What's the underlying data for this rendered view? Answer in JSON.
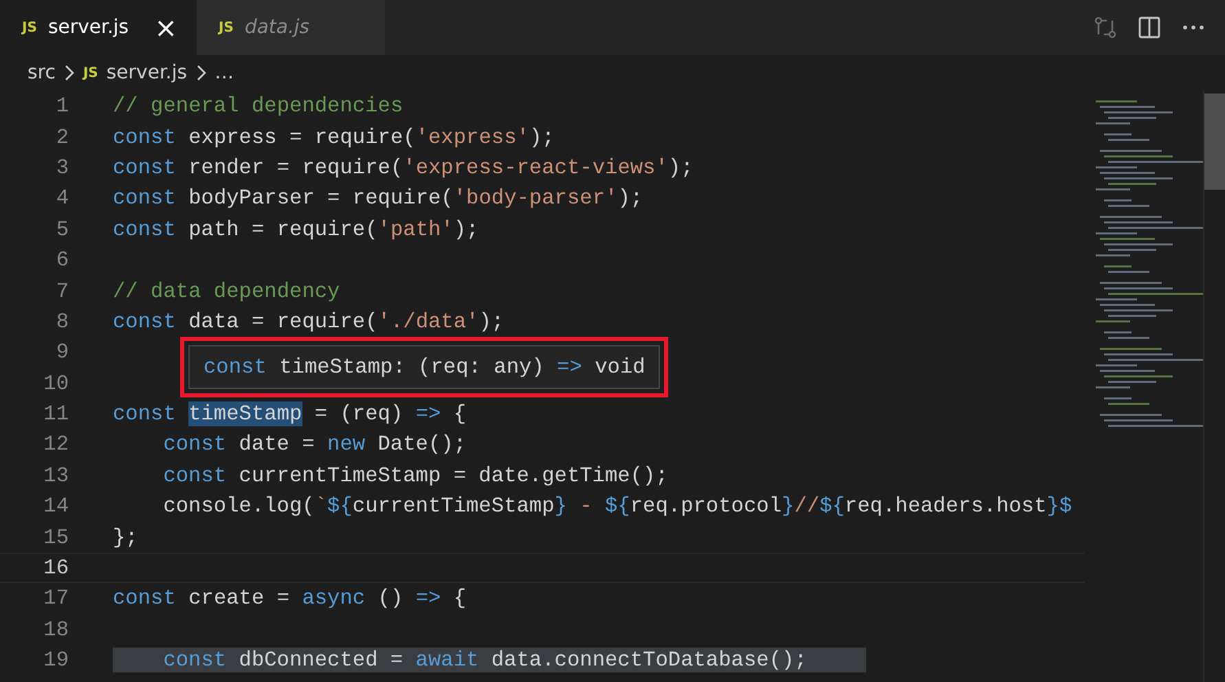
{
  "tabs": [
    {
      "label": "server.js",
      "icon": "JS",
      "selected": true,
      "preview": false,
      "close": "×"
    },
    {
      "label": "data.js",
      "icon": "JS",
      "selected": false,
      "preview": true
    }
  ],
  "breadcrumbs": [
    {
      "label": "src"
    },
    {
      "label": "server.js",
      "icon": "JS"
    },
    {
      "label": "…"
    }
  ],
  "lines": [
    {
      "number": "1",
      "tokens": [
        {
          "kind": "cmt",
          "text": "// general dependencies"
        }
      ]
    },
    {
      "number": "2",
      "tokens": [
        {
          "kind": "kw",
          "text": "const"
        },
        {
          "kind": "id",
          "text": " express = require("
        },
        {
          "kind": "str",
          "text": "'express'"
        },
        {
          "kind": "id",
          "text": ");"
        }
      ]
    },
    {
      "number": "3",
      "tokens": [
        {
          "kind": "kw",
          "text": "const"
        },
        {
          "kind": "id",
          "text": " render = require("
        },
        {
          "kind": "str",
          "text": "'express-react-views'"
        },
        {
          "kind": "id",
          "text": ");"
        }
      ]
    },
    {
      "number": "4",
      "tokens": [
        {
          "kind": "kw",
          "text": "const"
        },
        {
          "kind": "id",
          "text": " bodyParser = require("
        },
        {
          "kind": "str",
          "text": "'body-parser'"
        },
        {
          "kind": "id",
          "text": ");"
        }
      ]
    },
    {
      "number": "5",
      "tokens": [
        {
          "kind": "kw",
          "text": "const"
        },
        {
          "kind": "id",
          "text": " path = require("
        },
        {
          "kind": "str",
          "text": "'path'"
        },
        {
          "kind": "id",
          "text": ");"
        }
      ]
    },
    {
      "number": "6"
    },
    {
      "number": "7",
      "tokens": [
        {
          "kind": "cmt",
          "text": "// data dependency"
        }
      ]
    },
    {
      "number": "8",
      "tokens": [
        {
          "kind": "kw",
          "text": "const"
        },
        {
          "kind": "id",
          "text": " data = require("
        },
        {
          "kind": "str",
          "text": "'./data'"
        },
        {
          "kind": "id",
          "text": ");"
        }
      ]
    },
    {
      "number": "9"
    },
    {
      "number": "10"
    },
    {
      "number": "11",
      "tokens": [
        {
          "kind": "kw",
          "text": "const "
        },
        {
          "kind": "id",
          "text": "timeStamp",
          "highlighted": true
        },
        {
          "kind": "id",
          "text": " = (req) "
        },
        {
          "kind": "kw",
          "text": "=>"
        },
        {
          "kind": "id",
          "text": " {"
        }
      ]
    },
    {
      "number": "12",
      "indent": true,
      "tokens": [
        {
          "kind": "kw",
          "text": "const"
        },
        {
          "kind": "id",
          "text": " date = "
        },
        {
          "kind": "kw",
          "text": "new"
        },
        {
          "kind": "id",
          "text": " Date();"
        }
      ]
    },
    {
      "number": "13",
      "indent": true,
      "tokens": [
        {
          "kind": "kw",
          "text": "const"
        },
        {
          "kind": "id",
          "text": " currentTimeStamp = date.getTime();"
        }
      ]
    },
    {
      "number": "14",
      "indent": true,
      "tokens": [
        {
          "kind": "id",
          "text": "console.log("
        },
        {
          "kind": "str",
          "text": "`"
        },
        {
          "kind": "kw",
          "text": "${"
        },
        {
          "kind": "id",
          "text": "currentTimeStamp"
        },
        {
          "kind": "kw",
          "text": "}"
        },
        {
          "kind": "str",
          "text": " - "
        },
        {
          "kind": "kw",
          "text": "${"
        },
        {
          "kind": "id",
          "text": "req.protocol"
        },
        {
          "kind": "kw",
          "text": "}"
        },
        {
          "kind": "str",
          "text": "//"
        },
        {
          "kind": "kw",
          "text": "${"
        },
        {
          "kind": "id",
          "text": "req.headers.host"
        },
        {
          "kind": "kw",
          "text": "}$"
        }
      ]
    },
    {
      "number": "15",
      "tokens": [
        {
          "kind": "id",
          "text": "};"
        }
      ]
    },
    {
      "number": "16",
      "current": true
    },
    {
      "number": "17",
      "tokens": [
        {
          "kind": "kw",
          "text": "const"
        },
        {
          "kind": "id",
          "text": " create = "
        },
        {
          "kind": "kw",
          "text": "async"
        },
        {
          "kind": "id",
          "text": " () "
        },
        {
          "kind": "kw",
          "text": "=>"
        },
        {
          "kind": "id",
          "text": " {"
        }
      ]
    },
    {
      "number": "18"
    },
    {
      "number": "19",
      "indent": true,
      "selected": true,
      "tokens": [
        {
          "kind": "kw",
          "text": "const"
        },
        {
          "kind": "id",
          "text": " dbConnected = "
        },
        {
          "kind": "kw",
          "text": "await"
        },
        {
          "kind": "id",
          "text": " data.connectToDatabase();"
        }
      ]
    }
  ],
  "hover": {
    "tokens": [
      {
        "kind": "kw",
        "text": "const"
      },
      {
        "kind": "id",
        "text": " timeStamp: (req: any) "
      },
      {
        "kind": "kw",
        "text": "=>"
      },
      {
        "kind": "id",
        "text": " void"
      }
    ]
  }
}
